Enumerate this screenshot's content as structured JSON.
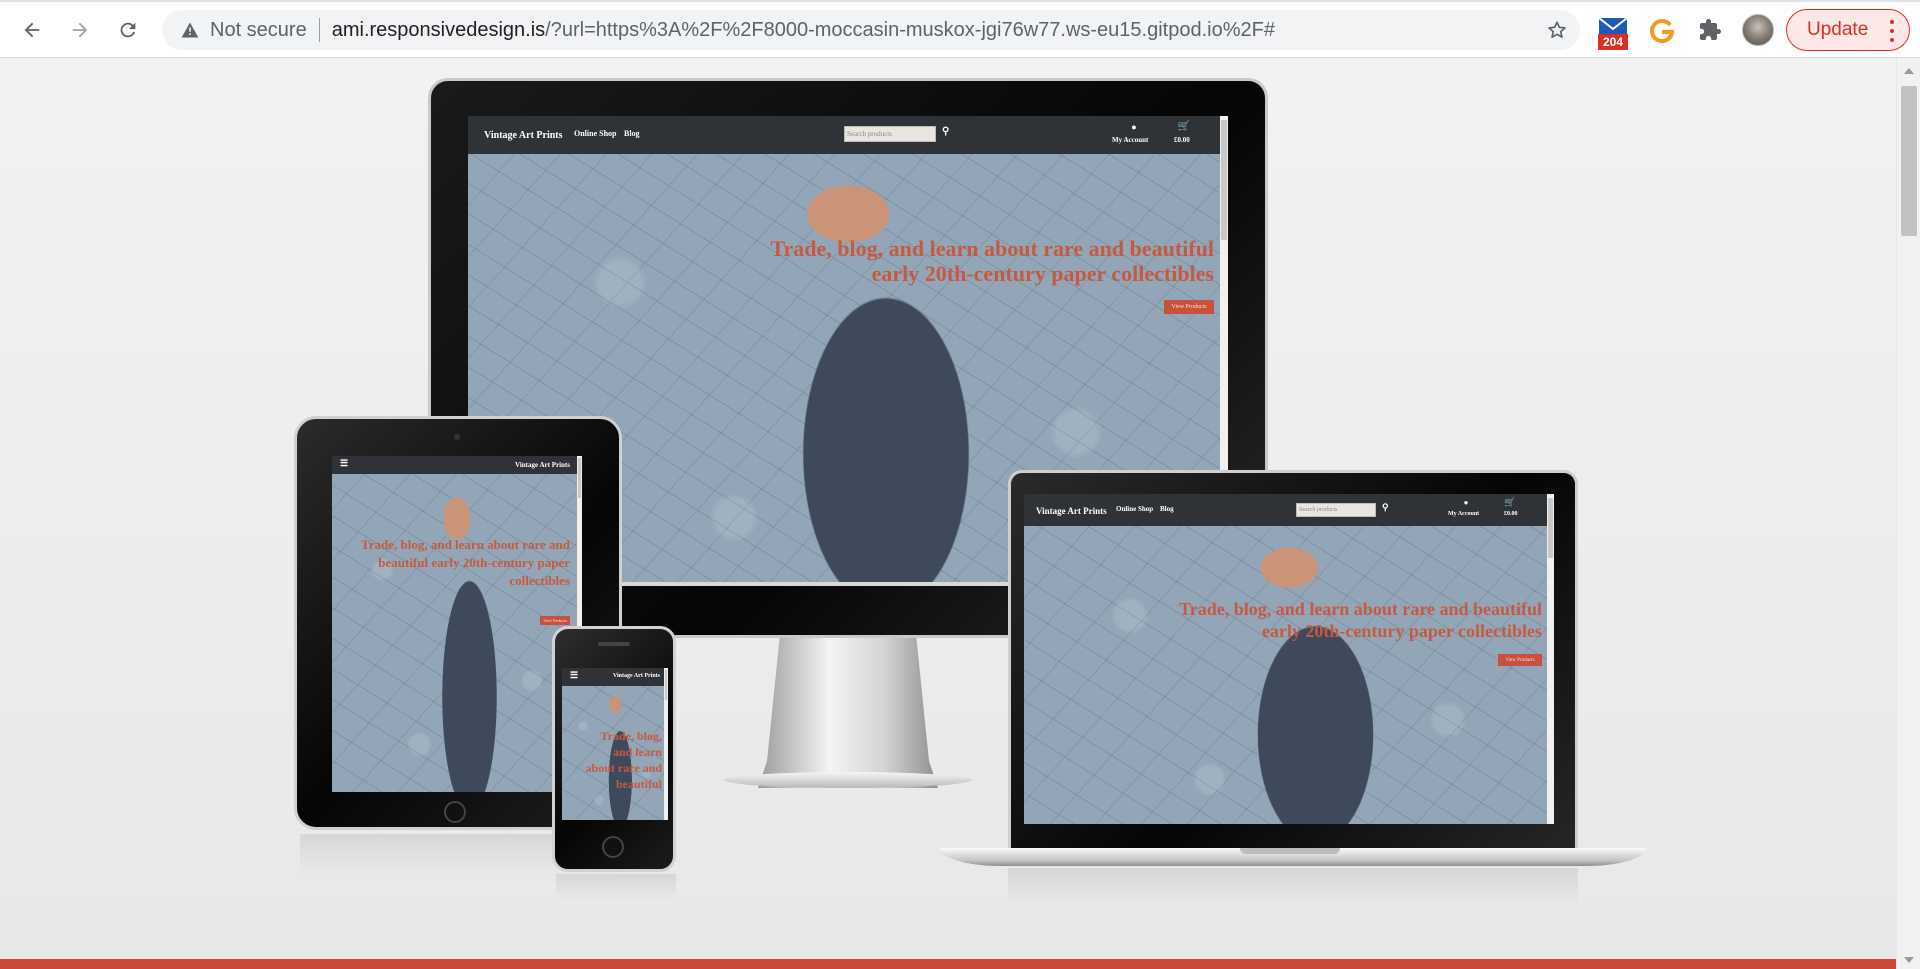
{
  "browser": {
    "status_text": "Not secure",
    "url_host": "ami.responsivedesign.is",
    "url_rest": "/?url=https%3A%2F%2F8000-moccasin-muskox-jgi76w77.ws-eu15.gitpod.io%2F#",
    "mail_badge_count": "204",
    "update_label": "Update",
    "icons": [
      "back-icon",
      "forward-icon",
      "reload-icon",
      "warning-icon",
      "star-icon",
      "mail-extension-icon",
      "g-extension-icon",
      "puzzle-icon",
      "avatar",
      "more-icon"
    ]
  },
  "site": {
    "brand": "Vintage Art Prints",
    "nav_links": [
      "Online Shop",
      "Blog"
    ],
    "search_placeholder": "Search products",
    "account_label": "My Account",
    "cart_total": "£0.00",
    "hero_headline": "Trade, blog, and learn about rare and beautiful early 20th-century paper collectibles",
    "hero_button": "View Products",
    "phone_headline_partial": "Trade, blog, and learn about rare and beautiful",
    "colors": {
      "nav_bg": "#2f3337",
      "hero_text": "#c65a40",
      "button_bg": "#c9503a",
      "footer_bar": "#c94a3a"
    }
  }
}
